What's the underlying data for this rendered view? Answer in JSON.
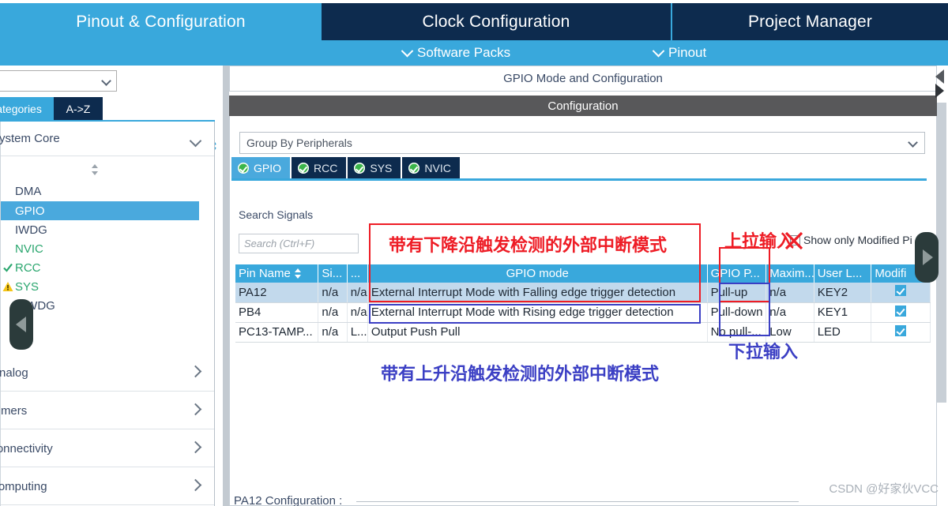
{
  "app": {
    "main_tabs": [
      {
        "label": "Pinout & Configuration",
        "state": "active"
      },
      {
        "label": "Clock Configuration",
        "state": "inactive"
      },
      {
        "label": "Project Manager",
        "state": "inactive"
      }
    ],
    "sub_tabs": [
      {
        "label": "Software Packs",
        "icon": "chevron-down-icon"
      },
      {
        "label": "Pinout",
        "icon": "chevron-down-icon"
      }
    ]
  },
  "sidebar": {
    "filter_combo": {
      "value": "",
      "icon": "chevron-down-icon"
    },
    "gear_icon": "gear-icon",
    "segments": [
      {
        "label": "Categories",
        "state": "active"
      },
      {
        "label": "A->Z",
        "state": "inactive"
      }
    ],
    "groups": [
      {
        "label": "System Core",
        "expanded": true,
        "chevron": "chevron-down-icon"
      },
      {
        "label": "Analog",
        "expanded": false,
        "chevron": "chevron-right-icon"
      },
      {
        "label": "Timers",
        "expanded": false,
        "chevron": "chevron-right-icon"
      },
      {
        "label": "Connectivity",
        "expanded": false,
        "chevron": "chevron-right-icon"
      },
      {
        "label": "Computing",
        "expanded": false,
        "chevron": "chevron-right-icon"
      }
    ],
    "peripherals": [
      {
        "label": "DMA",
        "state": "normal",
        "icon": ""
      },
      {
        "label": "GPIO",
        "state": "selected",
        "icon": ""
      },
      {
        "label": "IWDG",
        "state": "normal",
        "icon": ""
      },
      {
        "label": "NVIC",
        "state": "configured",
        "icon": ""
      },
      {
        "label": "RCC",
        "state": "configured",
        "icon": "check-icon"
      },
      {
        "label": "SYS",
        "state": "configured",
        "icon": "warning-icon"
      },
      {
        "label": "WWDG",
        "state": "normal",
        "icon": ""
      }
    ],
    "collapse_handle_icon": "triangle-left-icon"
  },
  "main": {
    "mode_header": "GPIO Mode and Configuration",
    "configuration_band": "Configuration",
    "group_by": {
      "value": "Group By Peripherals",
      "icon": "chevron-down-icon"
    },
    "peripheral_tabs": [
      {
        "label": "GPIO",
        "state": "active",
        "icon": "check-circle-icon"
      },
      {
        "label": "RCC",
        "state": "inactive",
        "icon": "check-circle-icon"
      },
      {
        "label": "SYS",
        "state": "inactive",
        "icon": "check-circle-icon"
      },
      {
        "label": "NVIC",
        "state": "inactive",
        "icon": "check-circle-icon"
      }
    ],
    "search_label": "Search Signals",
    "search_placeholder": "Search (Ctrl+F)",
    "show_only_modified": {
      "label": "Show only Modified Pi",
      "checked": false
    },
    "table": {
      "columns": [
        "Pin Name",
        "Si...",
        "...",
        "GPIO mode",
        "GPIO P...",
        "Maxim...",
        "User L...",
        "Modifi"
      ],
      "sort_column": "Pin Name",
      "sort_icon": "sort-arrows-icon",
      "rows": [
        {
          "pin_name": "PA12",
          "signal": "n/a",
          "col3": "n/a",
          "gpio_mode": "External Interrupt Mode with Falling edge trigger detection",
          "gpio_pull": "Pull-up",
          "maximum": "n/a",
          "user_label": "KEY2",
          "modified": true,
          "selected": true
        },
        {
          "pin_name": "PB4",
          "signal": "n/a",
          "col3": "n/a",
          "gpio_mode": "External Interrupt Mode with Rising edge trigger detection",
          "gpio_pull": "Pull-down",
          "maximum": "n/a",
          "user_label": "KEY1",
          "modified": true,
          "selected": false
        },
        {
          "pin_name": "PC13-TAMP...",
          "signal": "n/a",
          "col3": "L...",
          "gpio_mode": "Output Push Pull",
          "gpio_pull": "No pull-...",
          "maximum": "Low",
          "user_label": "LED",
          "modified": true,
          "selected": false
        }
      ]
    },
    "pin_config_title": "PA12 Configuration :",
    "collapse_handle_icon": "triangle-right-icon",
    "scroll_left_icon": "triangle-left-icon",
    "scroll_right_icon": "triangle-right-icon"
  },
  "annotations": [
    {
      "id": "falling",
      "text": "带有下降沿触发检测的外部中断模式",
      "color": "#ee1c25"
    },
    {
      "id": "pullup",
      "text": "上拉输入",
      "color": "#ee1c25"
    },
    {
      "id": "rising",
      "text": "带有上升沿触发检测的外部中断模式",
      "color": "#3b3fc4"
    },
    {
      "id": "pulldown",
      "text": "下拉输入",
      "color": "#3b3fc4"
    }
  ],
  "watermark": "CSDN @好家伙VCC",
  "colors": {
    "brand_blue": "#39a8dc",
    "dark_navy": "#0d2b4e",
    "band_gray": "#58585a",
    "annotation_red": "#ee1c25",
    "annotation_blue": "#3b3fc4",
    "row_selected": "#c2d9ec"
  }
}
